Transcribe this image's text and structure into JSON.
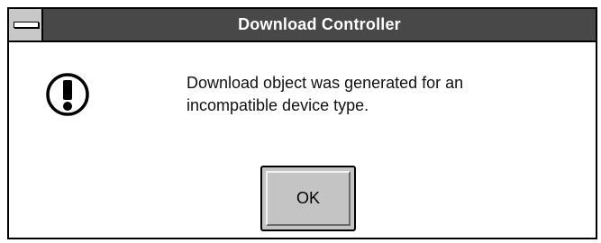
{
  "window": {
    "title": "Download Controller"
  },
  "message": {
    "line1": "Download object was generated for an",
    "line2": "incompatible device type."
  },
  "buttons": {
    "ok_label": "OK"
  },
  "icons": {
    "system_menu": "system-menu-icon",
    "alert": "exclamation-icon"
  }
}
